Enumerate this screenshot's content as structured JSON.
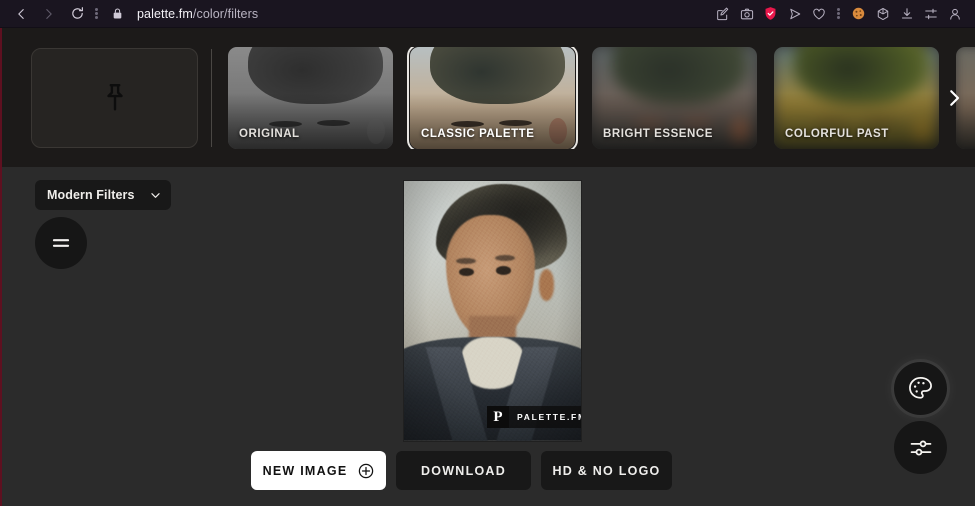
{
  "browser": {
    "url_host": "palette.fm",
    "url_path": "/color/filters",
    "nav": [
      {
        "name": "back-button",
        "icon": "chevron-left-icon"
      },
      {
        "name": "forward-button",
        "icon": "chevron-right-icon"
      },
      {
        "name": "reload-button",
        "icon": "reload-icon"
      }
    ],
    "lock_icon": "lock-icon",
    "toolbar_icons": [
      "annotate-icon",
      "screenshot-camera-icon",
      "shield-check-icon",
      "send-paper-plane-icon",
      "heart-icon",
      "cookie-icon",
      "cube-3d-icon",
      "download-icon",
      "sliders-settings-icon",
      "profile-person-icon"
    ],
    "accent_shield_color": "#e8174b"
  },
  "filter_strip": {
    "pin_card": {
      "label": "",
      "icon": "pin-icon"
    },
    "next_arrow_icon": "chevron-right-icon",
    "thumbnails": [
      {
        "label": "ORIGINAL",
        "selected": false,
        "style": "grayscale"
      },
      {
        "label": "CLASSIC PALETTE",
        "selected": true,
        "style": "classic"
      },
      {
        "label": "BRIGHT ESSENCE",
        "selected": false,
        "style": "bright"
      },
      {
        "label": "COLORFUL PAST",
        "selected": false,
        "style": "colorful"
      },
      {
        "label": "",
        "selected": false,
        "style": "partial"
      }
    ]
  },
  "editor": {
    "filters_dropdown": {
      "label": "Modern Filters",
      "chevron_icon": "chevron-down-icon"
    },
    "menu_button_icon": "menu-equals-icon",
    "palette_button_icon": "palette-icon",
    "sliders_button_icon": "adjust-sliders-icon",
    "preview": {
      "watermark_logo_letter": "P",
      "watermark_text": "PALETTE.FM"
    },
    "actions": [
      {
        "label": "NEW IMAGE",
        "style": "primary",
        "icon": "plus-circle-icon"
      },
      {
        "label": "DOWNLOAD",
        "style": "dark",
        "icon": ""
      },
      {
        "label": "HD & NO LOGO",
        "style": "dark",
        "icon": ""
      }
    ]
  }
}
